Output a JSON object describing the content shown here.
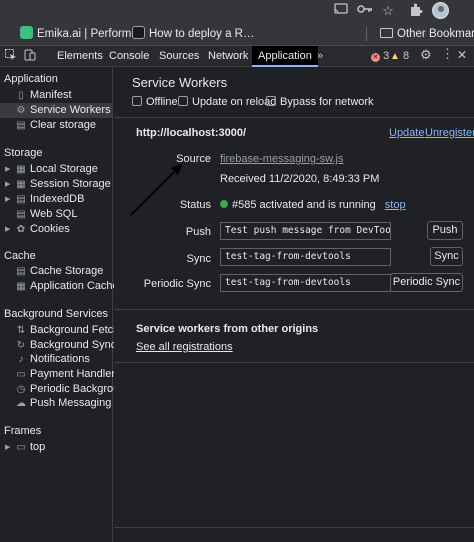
{
  "browser": {
    "icons": [
      "cast-icon",
      "key-icon",
      "star-icon",
      "extensions-icon"
    ],
    "bookmarks": [
      {
        "label": "Emika.ai | Perform…",
        "favicon_color": "#3fbf7f"
      },
      {
        "label": "How to deploy a R…",
        "favicon_color": "#1a1a1a"
      }
    ],
    "other_bookmarks": "Other Bookmarks"
  },
  "devtools": {
    "tabs": [
      "Elements",
      "Console",
      "Sources",
      "Network",
      "Application"
    ],
    "active_tab": "Application",
    "more": "»",
    "error_count": "3",
    "warning_count": "8"
  },
  "sidebar": {
    "application": {
      "title": "Application",
      "items": [
        "Manifest",
        "Service Workers",
        "Clear storage"
      ]
    },
    "storage": {
      "title": "Storage",
      "items": [
        "Local Storage",
        "Session Storage",
        "IndexedDB",
        "Web SQL",
        "Cookies"
      ]
    },
    "cache": {
      "title": "Cache",
      "items": [
        "Cache Storage",
        "Application Cache"
      ]
    },
    "background": {
      "title": "Background Services",
      "items": [
        "Background Fetch",
        "Background Sync",
        "Notifications",
        "Payment Handler",
        "Periodic Background",
        "Push Messaging"
      ]
    },
    "frames": {
      "title": "Frames",
      "items": [
        "top"
      ]
    }
  },
  "main": {
    "title": "Service Workers",
    "checkboxes": [
      "Offline",
      "Update on reload",
      "Bypass for network"
    ],
    "origin": "http://localhost:3000/",
    "update": "Update",
    "unregister": "Unregister",
    "source_label": "Source",
    "source_value": "firebase-messaging-sw.js",
    "received": "Received 11/2/2020, 8:49:33 PM",
    "status_label": "Status",
    "status_value": "#585 activated and is running",
    "stop": "stop",
    "push_label": "Push",
    "push_value": "Test push message from DevTools.",
    "push_button": "Push",
    "sync_label": "Sync",
    "sync_value": "test-tag-from-devtools",
    "sync_button": "Sync",
    "periodic_label": "Periodic Sync",
    "periodic_value": "test-tag-from-devtools",
    "periodic_button": "Periodic Sync",
    "others_title": "Service workers from other origins",
    "see_all": "See all registrations"
  },
  "colors": {
    "accent": "#8ab4f8",
    "status_green": "#34a853",
    "error": "#f28b82",
    "warning": "#fdd663"
  }
}
